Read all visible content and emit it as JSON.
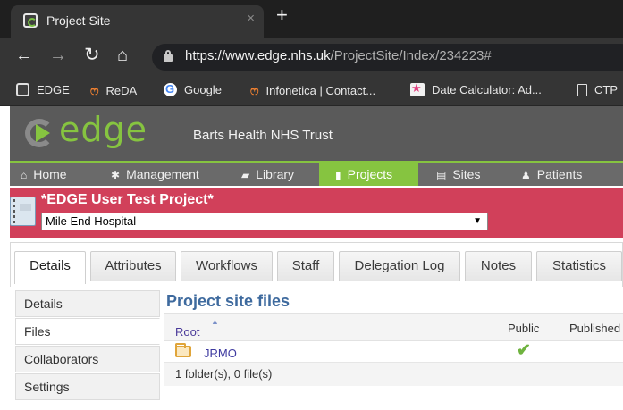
{
  "browser": {
    "tab_title": "Project Site",
    "tab_close": "×",
    "new_tab": "+",
    "url_host": "https://www.edge.nhs.uk",
    "url_path": "/ProjectSite/Index/234223#",
    "bookmarks": [
      {
        "label": "EDGE",
        "icon": "edge-icon"
      },
      {
        "label": "ReDA",
        "icon": "reda-icon"
      },
      {
        "label": "Google",
        "icon": "google-icon"
      },
      {
        "label": "Infonetica | Contact...",
        "icon": "infonetica-icon"
      },
      {
        "label": "Date Calculator: Ad...",
        "icon": "date-calculator-icon"
      },
      {
        "label": "CTP",
        "icon": "document-icon"
      }
    ]
  },
  "app": {
    "logo_text": "edge",
    "trust_name": "Barts Health NHS Trust",
    "nav": [
      {
        "label": "Home",
        "icon": "home-icon"
      },
      {
        "label": "Management",
        "icon": "gear-icon"
      },
      {
        "label": "Library",
        "icon": "book-icon"
      },
      {
        "label": "Projects",
        "icon": "document-icon"
      },
      {
        "label": "Sites",
        "icon": "building-icon"
      },
      {
        "label": "Patients",
        "icon": "person-icon"
      }
    ],
    "active_nav": "Projects"
  },
  "project": {
    "title": "*EDGE User Test Project*",
    "site_selected": "Mile End Hospital"
  },
  "tabs": [
    "Details",
    "Attributes",
    "Workflows",
    "Staff",
    "Delegation Log",
    "Notes",
    "Statistics"
  ],
  "active_tab": "Details",
  "submenu": [
    "Details",
    "Files",
    "Collaborators",
    "Settings"
  ],
  "active_submenu": "Files",
  "files": {
    "heading": "Project site files",
    "columns": {
      "root": "Root",
      "public": "Public",
      "published": "Published"
    },
    "rows": [
      {
        "name": "JRMO",
        "type": "folder",
        "public": true
      }
    ],
    "summary": "1 folder(s), 0 file(s)"
  },
  "colors": {
    "edge_green": "#86c440",
    "banner_red": "#d1405a",
    "heading_blue": "#3e6a9e"
  }
}
